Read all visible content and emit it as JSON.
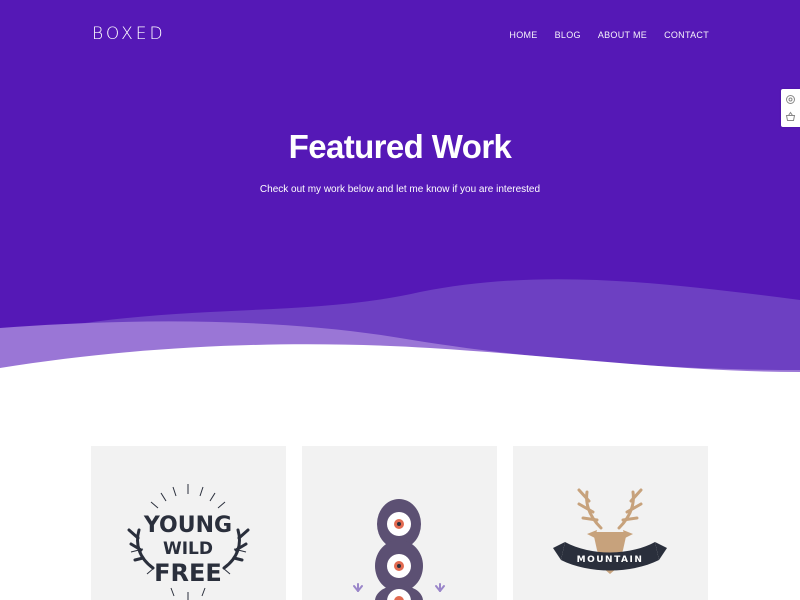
{
  "brand": {
    "logo_text": "BOXED"
  },
  "nav": {
    "items": [
      {
        "label": "HOME"
      },
      {
        "label": "BLOG"
      },
      {
        "label": "ABOUT ME"
      },
      {
        "label": "CONTACT"
      }
    ]
  },
  "side_tools": {
    "icons": [
      "gear-icon",
      "basket-icon"
    ]
  },
  "hero": {
    "title": "Featured Work",
    "subtitle": "Check out my work below and let me know if you are interested"
  },
  "colors": {
    "hero_bg": "#5518b6",
    "wave_mid": "#6d40c2",
    "wave_light": "#9a76d6",
    "card_bg": "#f2f2f2",
    "ink": "#2a2f3c",
    "deer": "#c7a27c"
  },
  "portfolio": {
    "items": [
      {
        "image": "young-wild-free-illustration",
        "lines": [
          "YOUNG",
          "WILD",
          "FREE"
        ]
      },
      {
        "image": "three-eyed-monster-illustration"
      },
      {
        "image": "deer-mountain-badge-illustration",
        "banner": "MOUNTAIN"
      }
    ]
  }
}
